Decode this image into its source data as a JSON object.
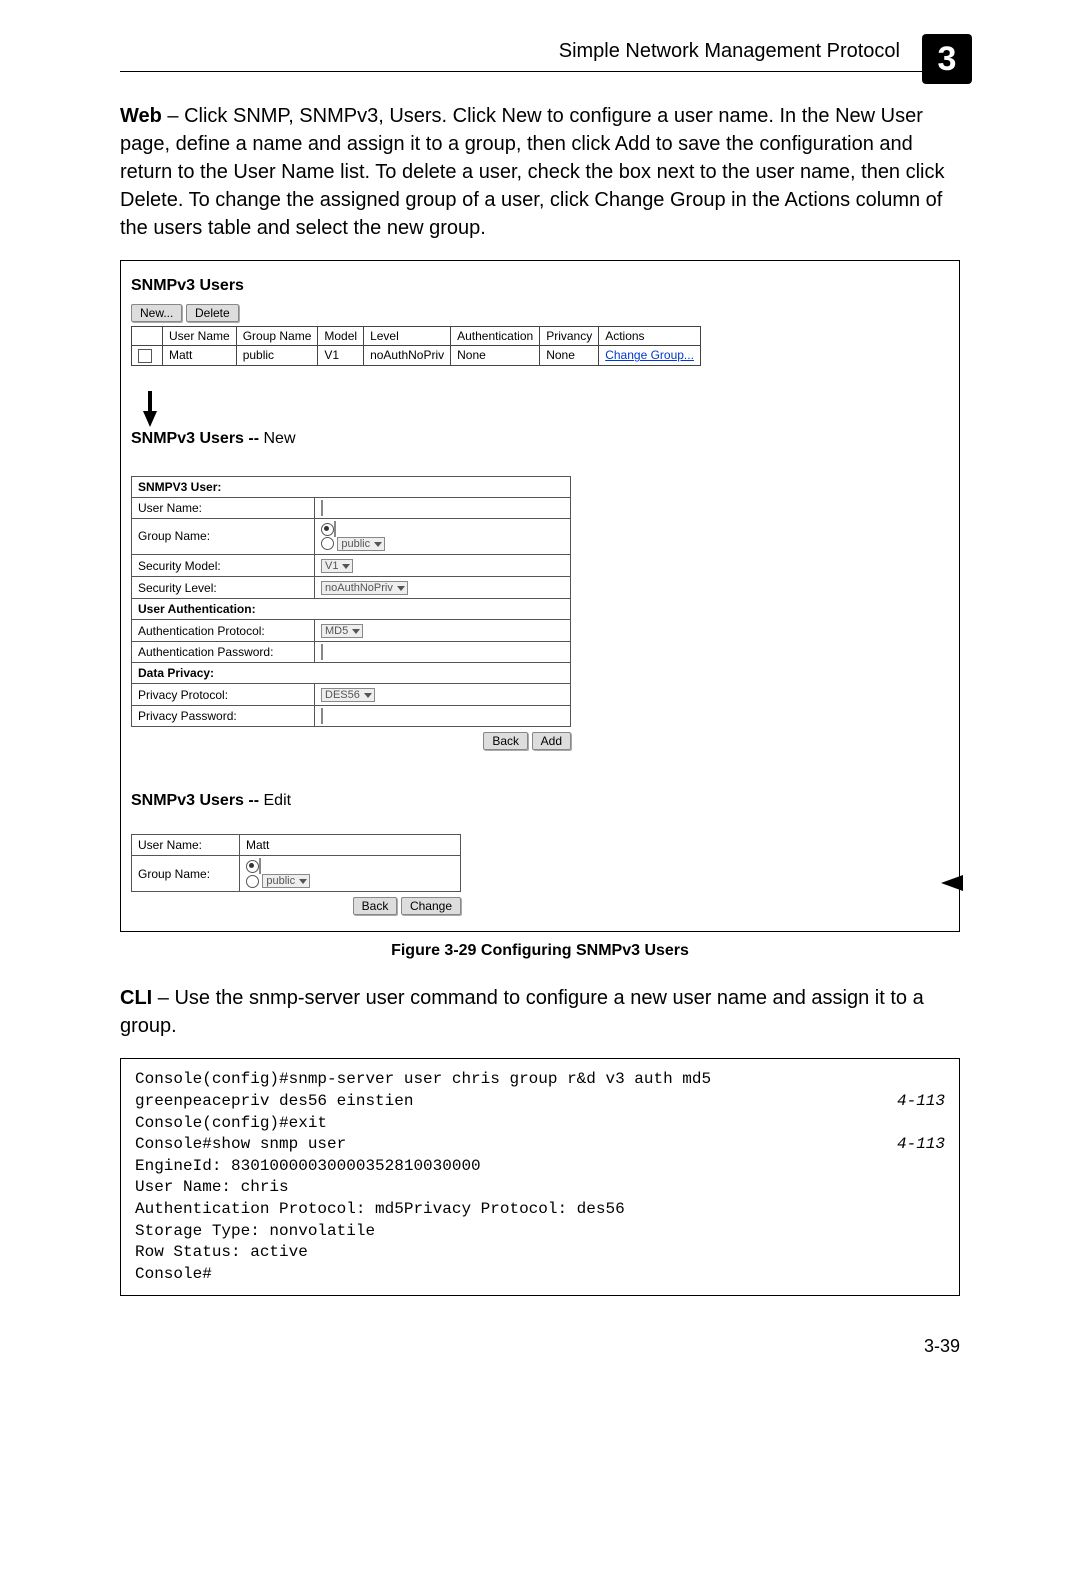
{
  "header": {
    "title": "Simple Network Management Protocol",
    "chapter": "3"
  },
  "web_para": {
    "lead": "Web",
    "body": " – Click SNMP, SNMPv3, Users. Click New to configure a user name. In the New User page, define a name and assign it to a group, then click Add to save the configuration and return to the User Name list. To delete a user, check the box next to the user name, then click Delete. To change the assigned group of a user, click Change Group in the Actions column of the users table and select the new group."
  },
  "figure": {
    "users_title": "SNMPv3 Users",
    "new_btn": "New...",
    "delete_btn": "Delete",
    "table": {
      "headers": [
        "",
        "User Name",
        "Group Name",
        "Model",
        "Level",
        "Authentication",
        "Privancy",
        "Actions"
      ],
      "row": {
        "user": "Matt",
        "group": "public",
        "model": "V1",
        "level": "noAuthNoPriv",
        "auth": "None",
        "priv": "None",
        "action": "Change Group..."
      }
    },
    "new_title_a": "SNMPv3 Users -- ",
    "new_title_b": "New",
    "new_form": {
      "hdr": "SNMPV3 User:",
      "username": "User Name:",
      "groupname": "Group Name:",
      "group_sel": "public",
      "secmodel": "Security Model:",
      "secmodel_sel": "V1",
      "seclevel": "Security Level:",
      "seclevel_sel": "noAuthNoPriv",
      "ua_hdr": "User Authentication:",
      "authproto": "Authentication Protocol:",
      "authproto_sel": "MD5",
      "authpwd": "Authentication Password:",
      "dp_hdr": "Data Privacy:",
      "privproto": "Privacy Protocol:",
      "privproto_sel": "DES56",
      "privpwd": "Privacy Password:",
      "back": "Back",
      "add": "Add"
    },
    "edit_title_a": "SNMPv3 Users -- ",
    "edit_title_b": "Edit",
    "edit_form": {
      "username": "User Name:",
      "username_val": "Matt",
      "groupname": "Group Name:",
      "group_sel": "public",
      "back": "Back",
      "change": "Change"
    },
    "caption": "Figure 3-29  Configuring SNMPv3 Users"
  },
  "cli_para": {
    "lead": "CLI",
    "body": " – Use the snmp-server user command to configure a new user name and assign it to a group."
  },
  "cli": {
    "l1": "Console(config)#snmp-server user chris group r&d v3 auth md5",
    "l2": "greenpeacepriv des56 einstien",
    "ref1": "4-113",
    "l3": "Console(config)#exit",
    "l4": "Console#show snmp user",
    "ref2": "4-113",
    "l5": "EngineId: 83010000030000352810030000",
    "l6": "User Name: chris",
    "l7": "Authentication Protocol: md5Privacy Protocol: des56",
    "l8": "Storage Type: nonvolatile",
    "l9": "Row Status: active",
    "l10": "Console#"
  },
  "page_num": "3-39"
}
